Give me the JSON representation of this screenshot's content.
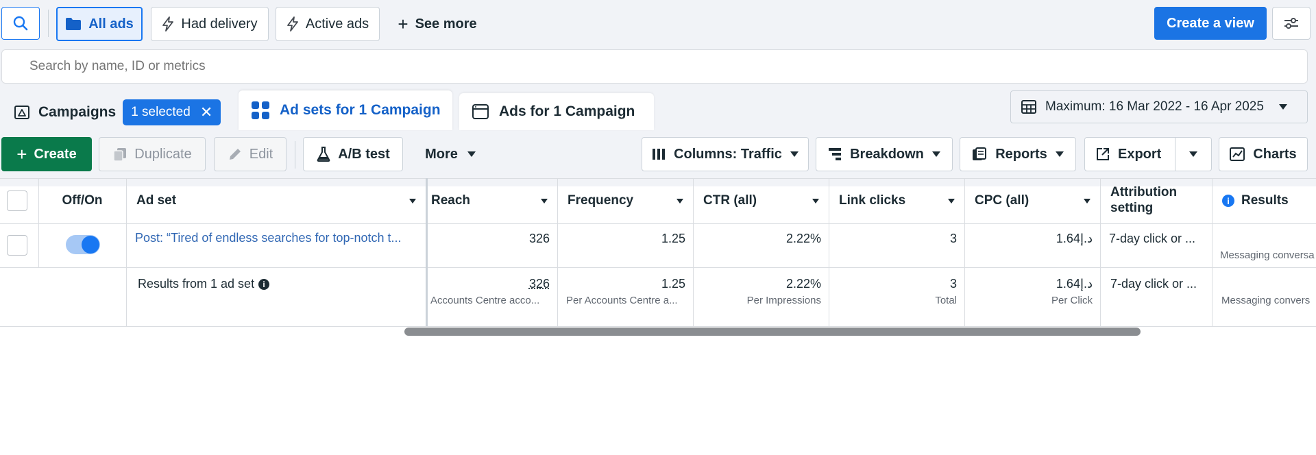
{
  "filters": {
    "all_ads": "All ads",
    "had_delivery": "Had delivery",
    "active_ads": "Active ads",
    "see_more": "See more",
    "create_view": "Create a view"
  },
  "search": {
    "placeholder": "Search by name, ID or metrics"
  },
  "tabs": {
    "campaigns": "Campaigns",
    "selected_badge": "1 selected",
    "ad_sets": "Ad sets for 1 Campaign",
    "ads": "Ads for 1 Campaign"
  },
  "date_range": "Maximum: 16 Mar 2022 - 16 Apr 2025",
  "toolbar": {
    "create": "Create",
    "duplicate": "Duplicate",
    "edit": "Edit",
    "ab_test": "A/B test",
    "more": "More",
    "columns": "Columns: Traffic",
    "breakdown": "Breakdown",
    "reports": "Reports",
    "export": "Export",
    "charts": "Charts"
  },
  "table": {
    "headers": {
      "off_on": "Off/On",
      "ad_set": "Ad set",
      "reach": "Reach",
      "frequency": "Frequency",
      "ctr": "CTR (all)",
      "link_clicks": "Link clicks",
      "cpc": "CPC (all)",
      "attribution_1": "Attribution",
      "attribution_2": "setting",
      "results": "Results"
    },
    "row": {
      "toggle_on": true,
      "name": "Post: “Tired of endless searches for top-notch t...",
      "reach": "326",
      "frequency": "1.25",
      "ctr": "2.22%",
      "link_clicks": "3",
      "cpc": "1.64د.إ",
      "attribution": "7-day click or ...",
      "results_sub": "Messaging conversa"
    },
    "summary": {
      "label": "Results from 1 ad set",
      "reach": "326",
      "reach_sub": "Accounts Centre acco...",
      "frequency": "1.25",
      "frequency_sub": "Per Accounts Centre a...",
      "ctr": "2.22%",
      "ctr_sub": "Per Impressions",
      "link_clicks": "3",
      "link_clicks_sub": "Total",
      "cpc": "1.64د.إ",
      "cpc_sub": "Per Click",
      "attribution": "7-day click or ...",
      "results_sub": "Messaging convers"
    }
  },
  "colors": {
    "accent": "#1877f2",
    "primary_button": "#1b74e4",
    "create_green": "#0a7a4b",
    "link_blue": "#2f66b3",
    "badge_blue": "#1b74e4"
  }
}
